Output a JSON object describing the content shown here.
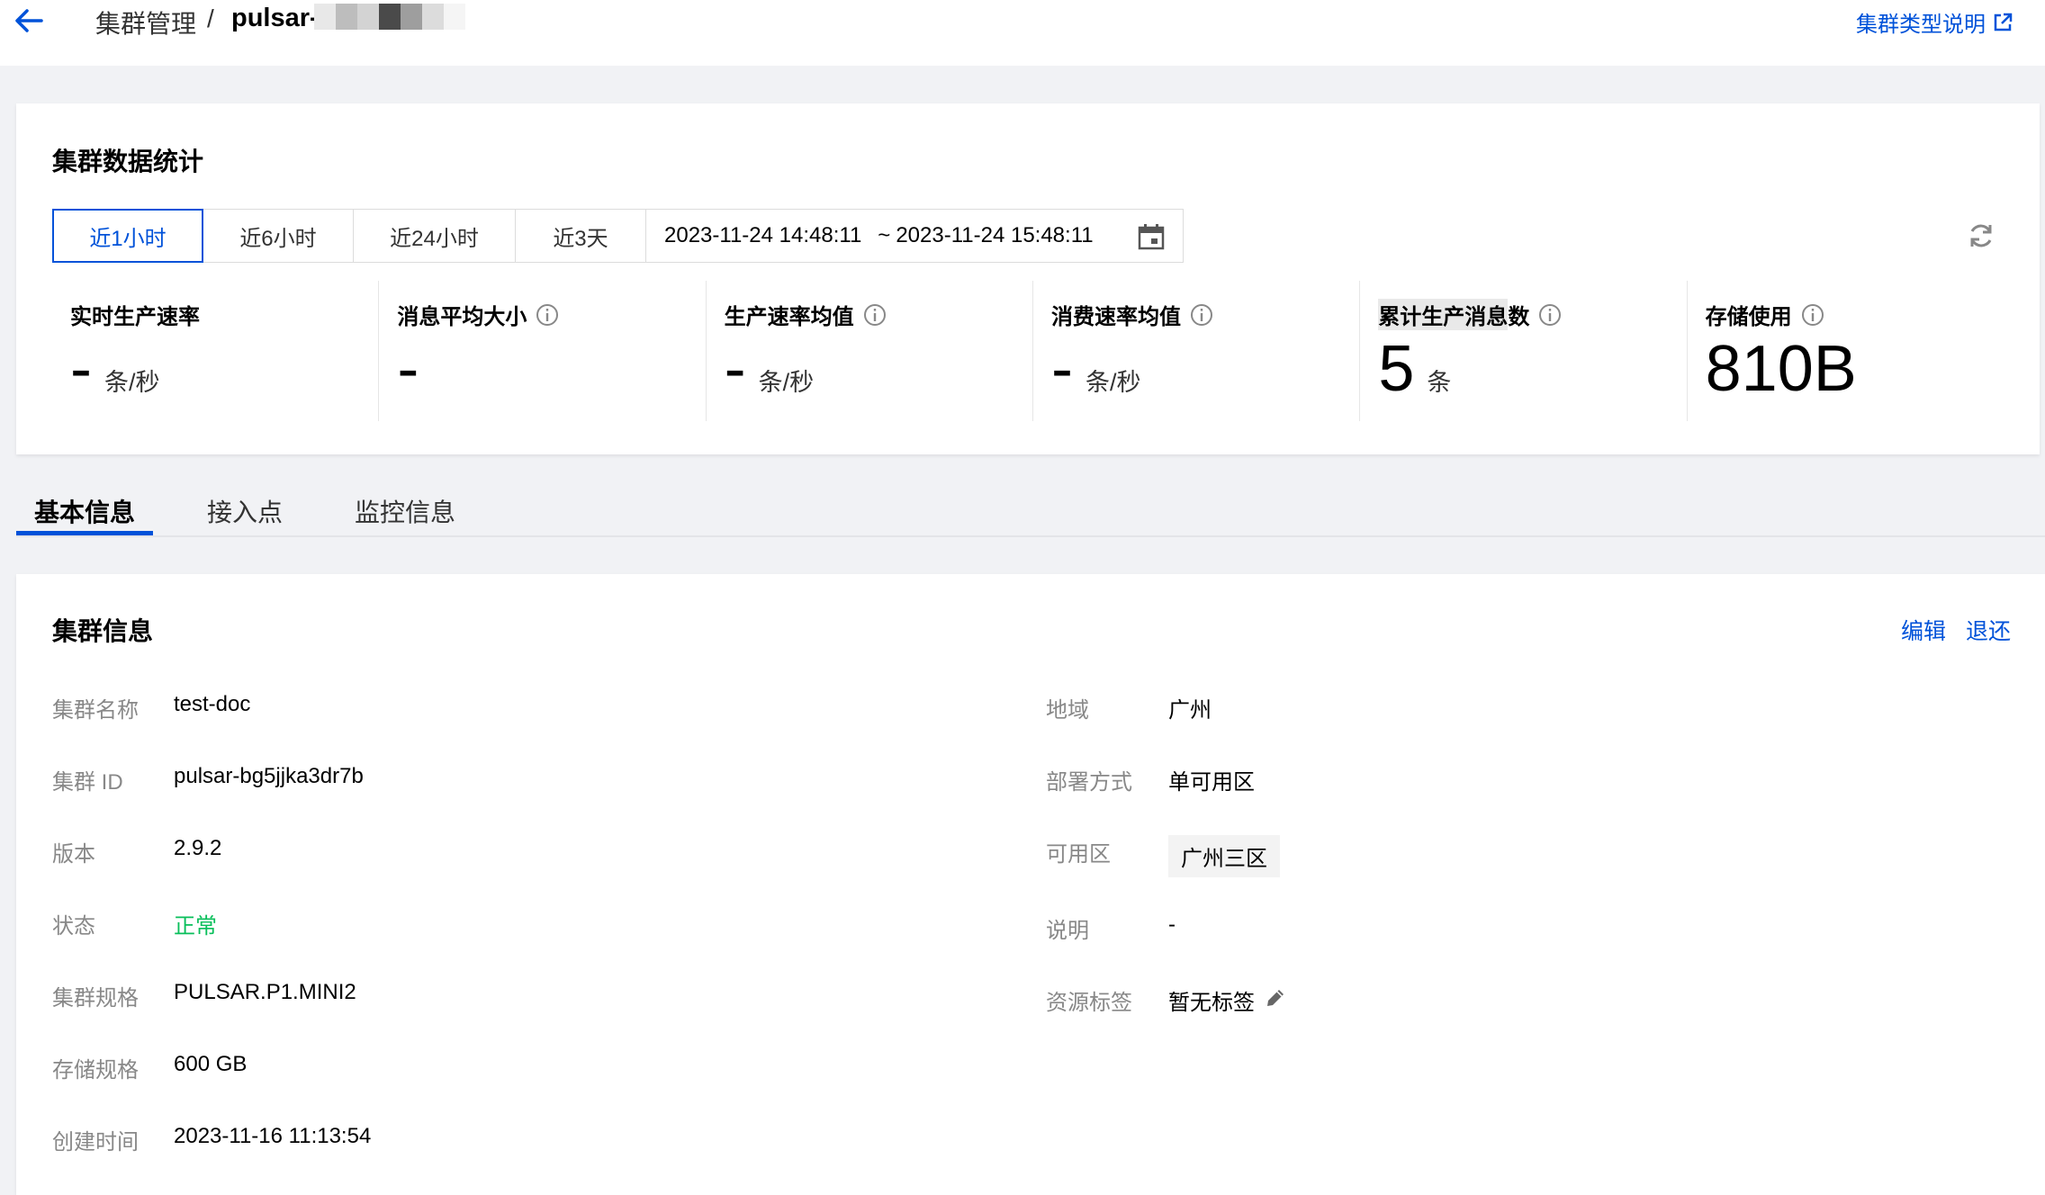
{
  "header": {
    "breadcrumb_parent": "集群管理",
    "separator": "/",
    "cluster_name_prefix": "pulsar-",
    "help_link": "集群类型说明",
    "accent_color": "#0052d9"
  },
  "stats": {
    "title": "集群数据统计",
    "ranges": [
      "近1小时",
      "近6小时",
      "近24小时",
      "近3天"
    ],
    "active_range": "近1小时",
    "start_time": "2023-11-24 14:48:11",
    "range_separator": "~",
    "end_time": "2023-11-24 15:48:11",
    "metrics": [
      {
        "label": "实时生产速率",
        "value": "-",
        "unit": "条/秒"
      },
      {
        "label": "消息平均大小",
        "value": "-",
        "unit": ""
      },
      {
        "label": "生产速率均值",
        "value": "-",
        "unit": "条/秒"
      },
      {
        "label": "消费速率均值",
        "value": "-",
        "unit": "条/秒"
      },
      {
        "label_highlight": "累计生产消息",
        "label_rest": "数",
        "value": "5",
        "unit": "条"
      },
      {
        "label": "存储使用",
        "value": "810B",
        "unit": ""
      }
    ]
  },
  "tabs": [
    "基本信息",
    "接入点",
    "监控信息"
  ],
  "info": {
    "title": "集群信息",
    "actions": {
      "edit": "编辑",
      "return": "退还"
    },
    "left": [
      {
        "label": "集群名称",
        "value": "test-doc"
      },
      {
        "label": "集群 ID",
        "value": "pulsar-bg5jjka3dr7b"
      },
      {
        "label": "版本",
        "value": "2.9.2"
      },
      {
        "label": "状态",
        "value": "正常"
      },
      {
        "label": "集群规格",
        "value": "PULSAR.P1.MINI2"
      },
      {
        "label": "存储规格",
        "value": "600 GB"
      },
      {
        "label": "创建时间",
        "value": "2023-11-16 11:13:54"
      }
    ],
    "right": [
      {
        "label": "地域",
        "value": "广州"
      },
      {
        "label": "部署方式",
        "value": "单可用区"
      },
      {
        "label": "可用区",
        "value": "广州三区"
      },
      {
        "label": "说明",
        "value": "-"
      },
      {
        "label": "资源标签",
        "value": "暂无标签"
      }
    ],
    "status_color": "#0abf5b"
  }
}
